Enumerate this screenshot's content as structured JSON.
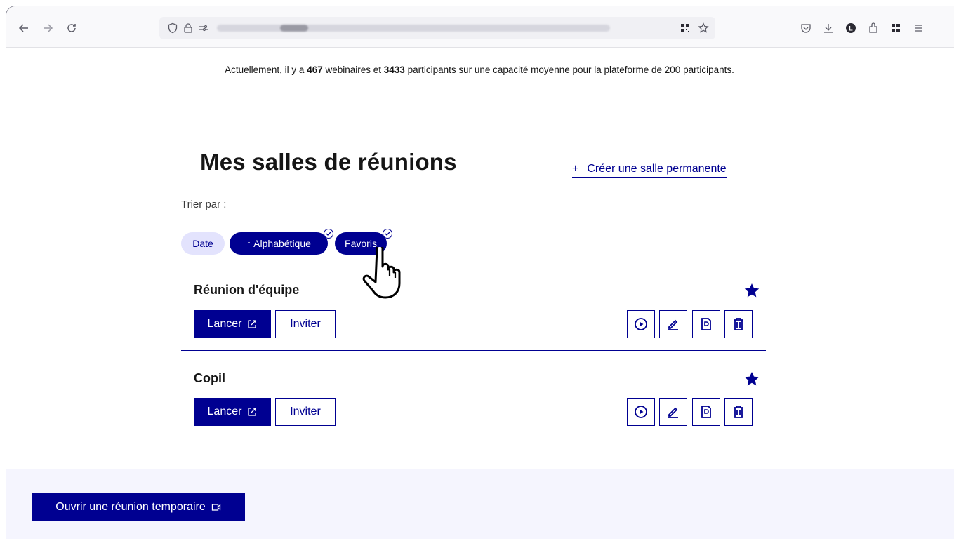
{
  "browser": {
    "nav": {
      "back": "back-arrow-icon",
      "forward": "forward-arrow-icon",
      "reload": "reload-icon"
    },
    "url_icons": [
      "shield-icon",
      "lock-icon",
      "permissions-icon"
    ],
    "right_icons": [
      "pocket-icon",
      "download-icon",
      "profile-icon",
      "extensions-icon",
      "apps-icon",
      "menu-icon"
    ]
  },
  "stats": {
    "prefix": "Actuellement, il y a ",
    "webinars": "467",
    "middle": " webinaires et ",
    "participants": "3433",
    "suffix": " participants sur une capacité moyenne pour la plateforme de 200 participants."
  },
  "page": {
    "title": "Mes salles de réunions",
    "create_link_plus": "+",
    "create_link": "Créer une salle permanente",
    "sort_label": "Trier par :"
  },
  "sort_tags": {
    "date": "Date",
    "alpha": "↑ Alphabétique",
    "favorites": "Favoris"
  },
  "rooms": [
    {
      "title": "Réunion d'équipe",
      "launch": "Lancer",
      "invite": "Inviter",
      "favorite": true
    },
    {
      "title": "Copil",
      "launch": "Lancer",
      "invite": "Inviter",
      "favorite": true
    }
  ],
  "footer": {
    "temp_button": "Ouvrir une réunion temporaire"
  },
  "colors": {
    "primary": "#000091",
    "tag_light": "#e3e3fd",
    "footer_bg": "#f5f5fe"
  }
}
